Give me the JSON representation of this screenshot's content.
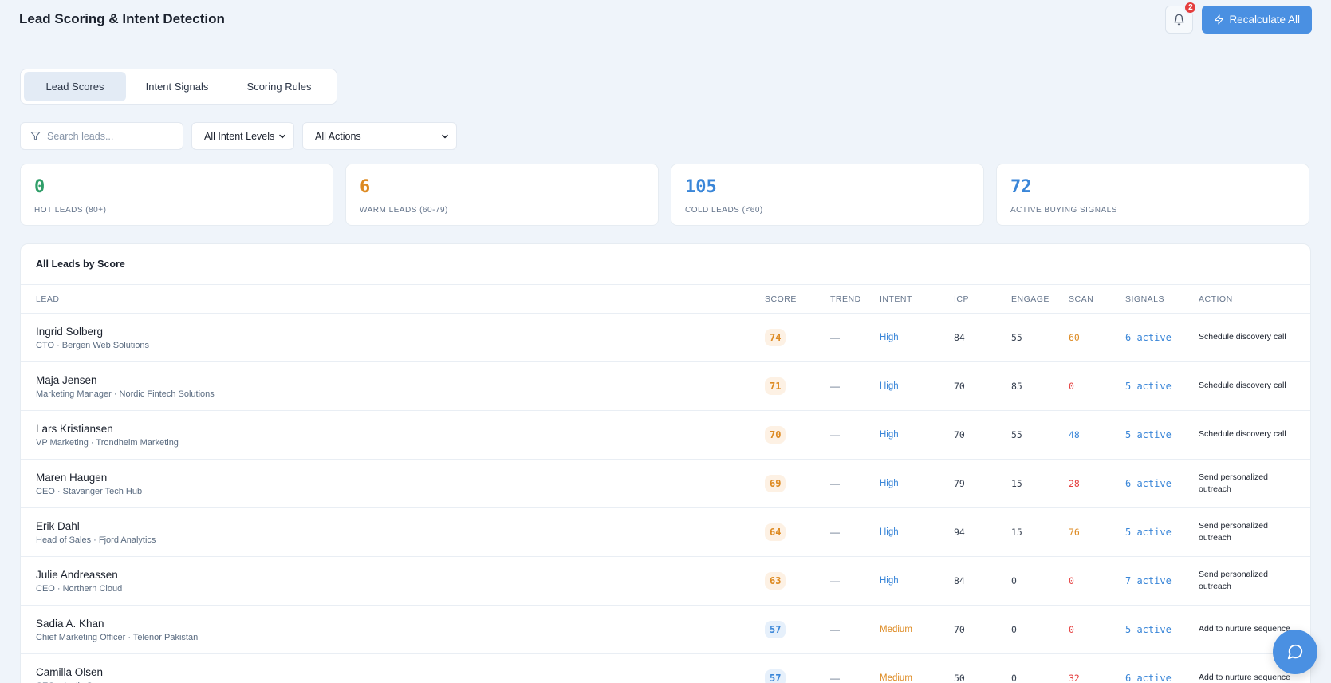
{
  "header": {
    "title": "Lead Scoring & Intent Detection",
    "notification_count": "2",
    "recalculate_label": "Recalculate All"
  },
  "tabs": [
    {
      "label": "Lead Scores",
      "active": true
    },
    {
      "label": "Intent Signals",
      "active": false
    },
    {
      "label": "Scoring Rules",
      "active": false
    }
  ],
  "filters": {
    "search_placeholder": "Search leads...",
    "intent_select": "All Intent Levels",
    "action_select": "All Actions"
  },
  "stats": [
    {
      "value": "0",
      "label": "HOT LEADS (80+)",
      "color": "#2f9e68"
    },
    {
      "value": "6",
      "label": "WARM LEADS (60-79)",
      "color": "#dd8a22"
    },
    {
      "value": "105",
      "label": "COLD LEADS (<60)",
      "color": "#3a86d8"
    },
    {
      "value": "72",
      "label": "ACTIVE BUYING SIGNALS",
      "color": "#3a86d8"
    }
  ],
  "table": {
    "title": "All Leads by Score",
    "columns": [
      "LEAD",
      "SCORE",
      "TREND",
      "INTENT",
      "ICP",
      "ENGAGE",
      "SCAN",
      "SIGNALS",
      "ACTION"
    ],
    "rows": [
      {
        "name": "Ingrid Solberg",
        "sub": "CTO · Bergen Web Solutions",
        "score": "74",
        "score_tier": "warm",
        "trend": "—",
        "intent": "High",
        "icp": "84",
        "engage": "55",
        "scan": "60",
        "scan_color": "orange",
        "signals": "6 active",
        "action": "Schedule discovery call"
      },
      {
        "name": "Maja Jensen",
        "sub": "Marketing Manager · Nordic Fintech Solutions",
        "score": "71",
        "score_tier": "warm",
        "trend": "—",
        "intent": "High",
        "icp": "70",
        "engage": "85",
        "scan": "0",
        "scan_color": "red",
        "signals": "5 active",
        "action": "Schedule discovery call"
      },
      {
        "name": "Lars Kristiansen",
        "sub": "VP Marketing · Trondheim Marketing",
        "score": "70",
        "score_tier": "warm",
        "trend": "—",
        "intent": "High",
        "icp": "70",
        "engage": "55",
        "scan": "48",
        "scan_color": "blue",
        "signals": "5 active",
        "action": "Schedule discovery call"
      },
      {
        "name": "Maren Haugen",
        "sub": "CEO · Stavanger Tech Hub",
        "score": "69",
        "score_tier": "warm",
        "trend": "—",
        "intent": "High",
        "icp": "79",
        "engage": "15",
        "scan": "28",
        "scan_color": "red",
        "signals": "6 active",
        "action": "Send personalized outreach"
      },
      {
        "name": "Erik Dahl",
        "sub": "Head of Sales · Fjord Analytics",
        "score": "64",
        "score_tier": "warm",
        "trend": "—",
        "intent": "High",
        "icp": "94",
        "engage": "15",
        "scan": "76",
        "scan_color": "orange",
        "signals": "5 active",
        "action": "Send personalized outreach"
      },
      {
        "name": "Julie Andreassen",
        "sub": "CEO · Northern Cloud",
        "score": "63",
        "score_tier": "warm",
        "trend": "—",
        "intent": "High",
        "icp": "84",
        "engage": "0",
        "scan": "0",
        "scan_color": "red",
        "signals": "7 active",
        "action": "Send personalized outreach"
      },
      {
        "name": "Sadia A. Khan",
        "sub": "Chief Marketing Officer · Telenor Pakistan",
        "score": "57",
        "score_tier": "cold",
        "trend": "—",
        "intent": "Medium",
        "icp": "70",
        "engage": "0",
        "scan": "0",
        "scan_color": "red",
        "signals": "5 active",
        "action": "Add to nurture sequence"
      },
      {
        "name": "Camilla Olsen",
        "sub": "CEO · Arctic Sy...",
        "score": "57",
        "score_tier": "cold",
        "trend": "—",
        "intent": "Medium",
        "icp": "50",
        "engage": "0",
        "scan": "32",
        "scan_color": "red",
        "signals": "6 active",
        "action": "Add to nurture sequence"
      }
    ]
  }
}
